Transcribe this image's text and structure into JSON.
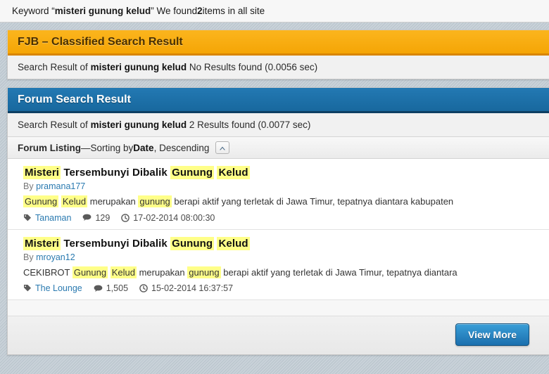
{
  "keyword_bar": {
    "prefix": "Keyword “",
    "keyword": "misteri gunung kelud",
    "middle": "” We found ",
    "count": "2",
    "suffix": " items in all site"
  },
  "fjb_panel": {
    "title": "FJB – Classified Search Result",
    "result_prefix": "Search Result of ",
    "result_keyword": "misteri gunung kelud",
    "result_suffix": " No Results found (0.0056 sec)"
  },
  "forum_panel": {
    "title": "Forum Search Result",
    "result_prefix": "Search Result of ",
    "result_keyword": "misteri gunung kelud",
    "result_suffix": " 2 Results found (0.0077 sec)"
  },
  "listing_bar": {
    "label": "Forum Listing",
    "dash": " — ",
    "sorting_text": "Sorting by ",
    "sort_field": "Date",
    "sort_direction": ", Descending",
    "sort_toggle_icon": "chevron-up-icon"
  },
  "results": [
    {
      "title_parts": [
        {
          "text": "Misteri",
          "highlight": true
        },
        {
          "text": " Tersembunyi Dibalik ",
          "highlight": false
        },
        {
          "text": "Gunung",
          "highlight": true
        },
        {
          "text": " ",
          "highlight": false
        },
        {
          "text": "Kelud",
          "highlight": true
        }
      ],
      "by_label": "By ",
      "author": "pramana177",
      "snippet_parts": [
        {
          "text": "Gunung",
          "highlight": true
        },
        {
          "text": " ",
          "highlight": false
        },
        {
          "text": "Kelud",
          "highlight": true
        },
        {
          "text": " merupakan ",
          "highlight": false
        },
        {
          "text": "gunung",
          "highlight": true
        },
        {
          "text": " berapi aktif yang terletak di Jawa Timur, tepatnya diantara kabupaten",
          "highlight": false
        }
      ],
      "tag_icon": "tag-icon",
      "tag": "Tanaman",
      "comment_icon": "comment-icon",
      "comments": "129",
      "clock_icon": "clock-icon",
      "date": "17-02-2014 08:00:30"
    },
    {
      "title_parts": [
        {
          "text": "Misteri",
          "highlight": true
        },
        {
          "text": " Tersembunyi Dibalik ",
          "highlight": false
        },
        {
          "text": "Gunung",
          "highlight": true
        },
        {
          "text": " ",
          "highlight": false
        },
        {
          "text": "Kelud",
          "highlight": true
        }
      ],
      "by_label": "By ",
      "author": "mroyan12",
      "snippet_parts": [
        {
          "text": "CEKIBROT ",
          "highlight": false
        },
        {
          "text": "Gunung",
          "highlight": true
        },
        {
          "text": " ",
          "highlight": false
        },
        {
          "text": "Kelud",
          "highlight": true
        },
        {
          "text": " merupakan ",
          "highlight": false
        },
        {
          "text": "gunung",
          "highlight": true
        },
        {
          "text": " berapi aktif yang terletak di Jawa Timur, tepatnya diantara",
          "highlight": false
        }
      ],
      "tag_icon": "tag-icon",
      "tag": "The Lounge",
      "comment_icon": "comment-icon",
      "comments": "1,505",
      "clock_icon": "clock-icon",
      "date": "15-02-2014 16:37:57"
    }
  ],
  "footer": {
    "view_more_label": "View More"
  },
  "colors": {
    "orange_header": "#f5a505",
    "blue_header": "#18689e",
    "highlight": "#ffff88",
    "link": "#2a7ab0",
    "button_blue": "#1b6fae"
  }
}
